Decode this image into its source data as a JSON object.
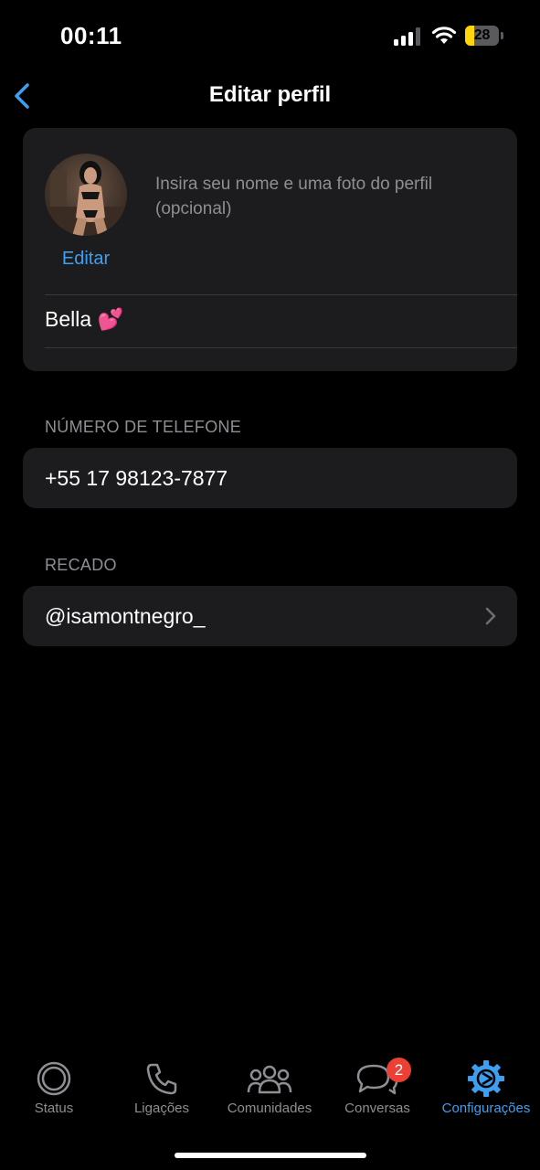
{
  "status_bar": {
    "time": "00:11",
    "battery_level": "28",
    "battery_fraction": 0.28,
    "signal_bars_active": 3,
    "signal_bars_total": 4
  },
  "header": {
    "title": "Editar perfil",
    "back_icon": "chevron-left-icon"
  },
  "profile": {
    "edit_label": "Editar",
    "hint": "Insira seu nome e uma foto do perfil (opcional)",
    "name_value": "Bella 💕"
  },
  "phone_section": {
    "label": "NÚMERO DE TELEFONE",
    "value": "+55 17 98123-7877"
  },
  "about_section": {
    "label": "RECADO",
    "value": "@isamontnegro_"
  },
  "tabs": [
    {
      "label": "Status",
      "icon": "status-icon",
      "active": false
    },
    {
      "label": "Ligações",
      "icon": "phone-icon",
      "active": false
    },
    {
      "label": "Comunidades",
      "icon": "communities-icon",
      "active": false
    },
    {
      "label": "Conversas",
      "icon": "chats-icon",
      "active": false,
      "badge": "2"
    },
    {
      "label": "Configurações",
      "icon": "gear-icon",
      "active": true
    }
  ],
  "colors": {
    "accent": "#3e9ff0",
    "badge": "#eb4034",
    "card_bg": "#1c1c1e",
    "secondary_text": "#8e8e93"
  }
}
